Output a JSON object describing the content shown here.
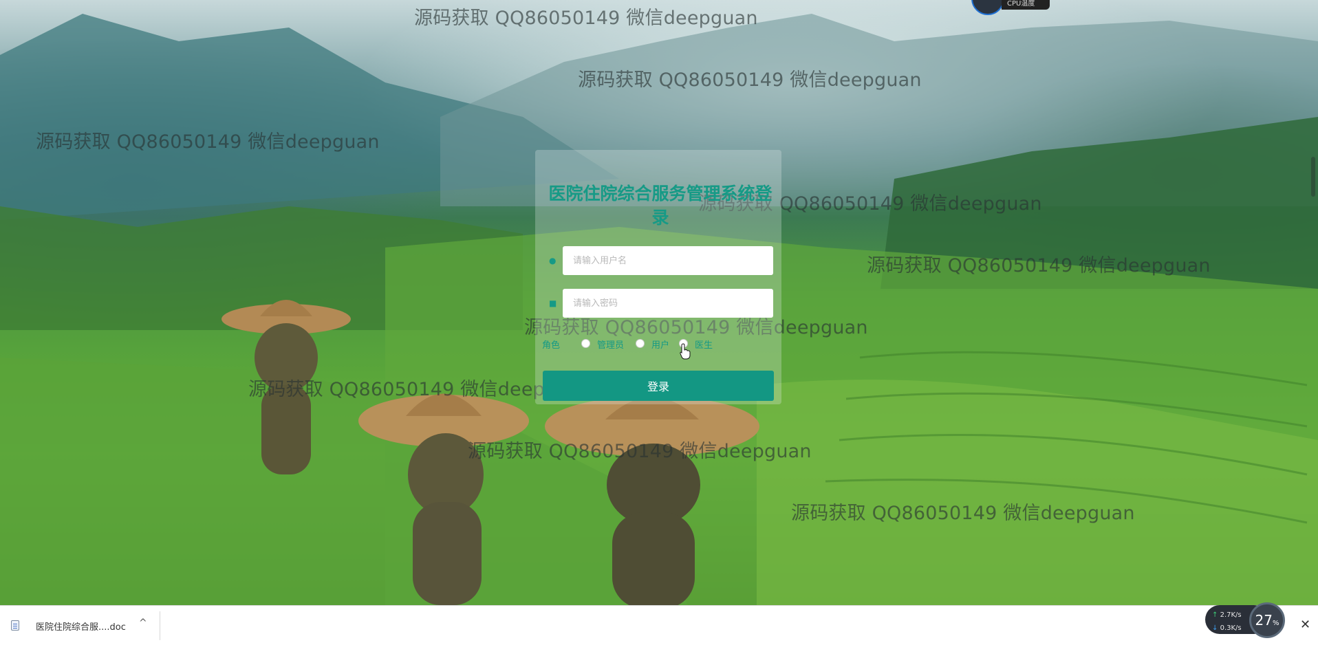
{
  "watermark_text": "源码获取 QQ86050149 微信deepguan",
  "login": {
    "title": "医院住院综合服务管理系统登录",
    "username_placeholder": "请输入用户名",
    "password_placeholder": "请输入密码",
    "role_label": "角色",
    "roles": [
      "管理员",
      "用户",
      "医生"
    ],
    "submit_label": "登录"
  },
  "top_widget": {
    "label": "CPU温度"
  },
  "download_bar": {
    "file_name": "医院住院综合服....doc",
    "chevron": "^",
    "close": "✕"
  },
  "net_widget": {
    "upload": "2.7",
    "download": "0.3",
    "unit": "K/s",
    "percent": "27",
    "percent_unit": "%"
  },
  "colors": {
    "accent": "#169a86",
    "button": "#139783"
  },
  "icons": [
    "user-icon",
    "lock-icon",
    "file-doc-icon",
    "chevron-up-icon",
    "close-icon",
    "cursor-hand-icon"
  ]
}
